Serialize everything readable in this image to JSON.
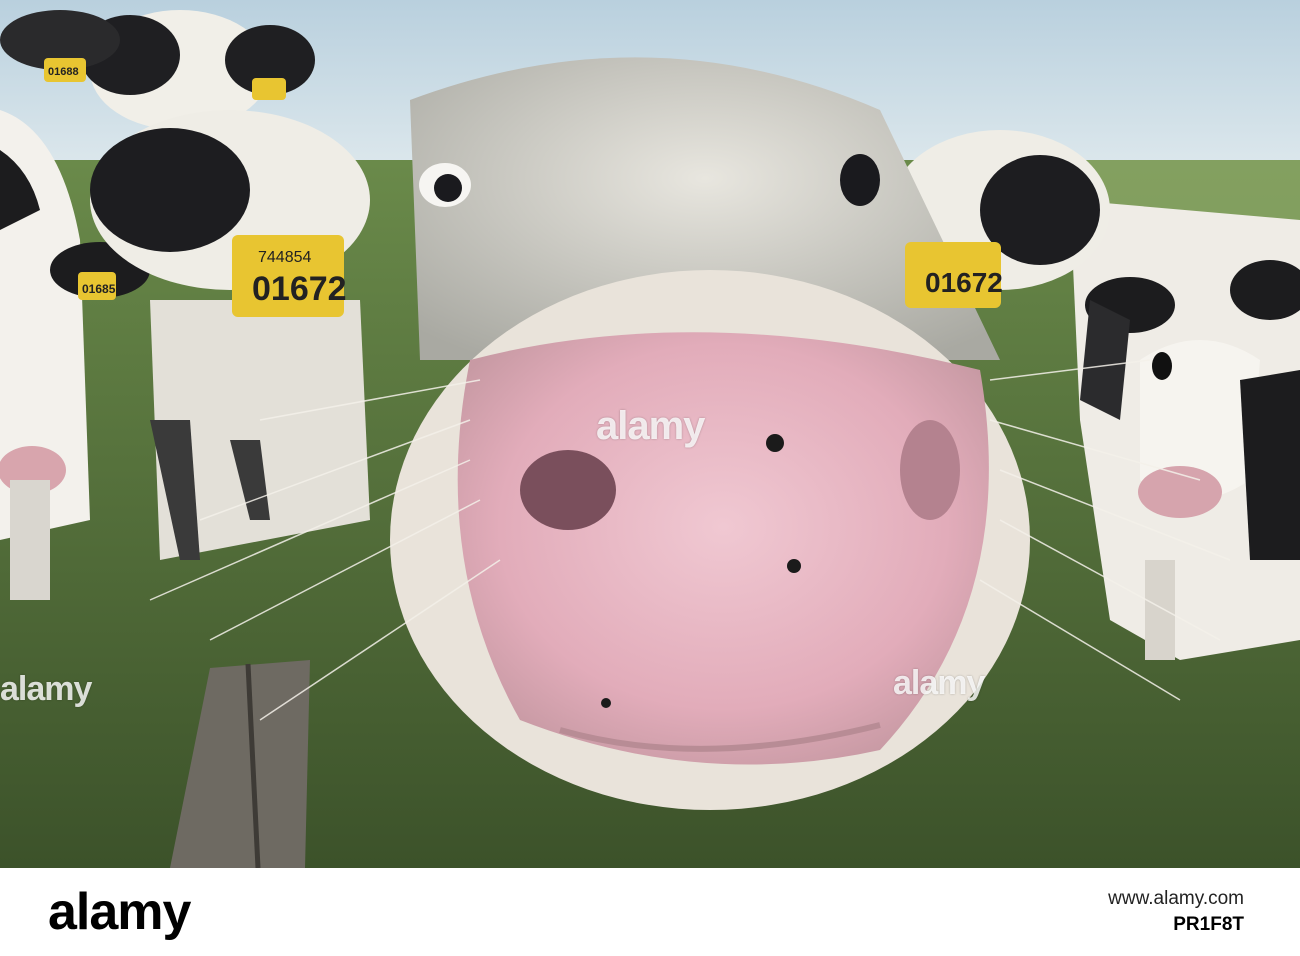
{
  "photo": {
    "ear_tag_left_top": "744854",
    "ear_tag_left_main": "01672",
    "ear_tag_right": "01672",
    "ear_tag_far_left": "01685",
    "ear_tag_back_left": "01688"
  },
  "watermarks": {
    "center": "alamy",
    "left": "alamy",
    "right": "alamy"
  },
  "footer": {
    "logo": "alamy",
    "caption": "www.alamy.com",
    "image_id": "PR1F8T"
  },
  "colors": {
    "sky": "#c9dbe6",
    "grass": "#4f6a37",
    "nose": "#e8b8c4",
    "tag": "#e8c531"
  }
}
